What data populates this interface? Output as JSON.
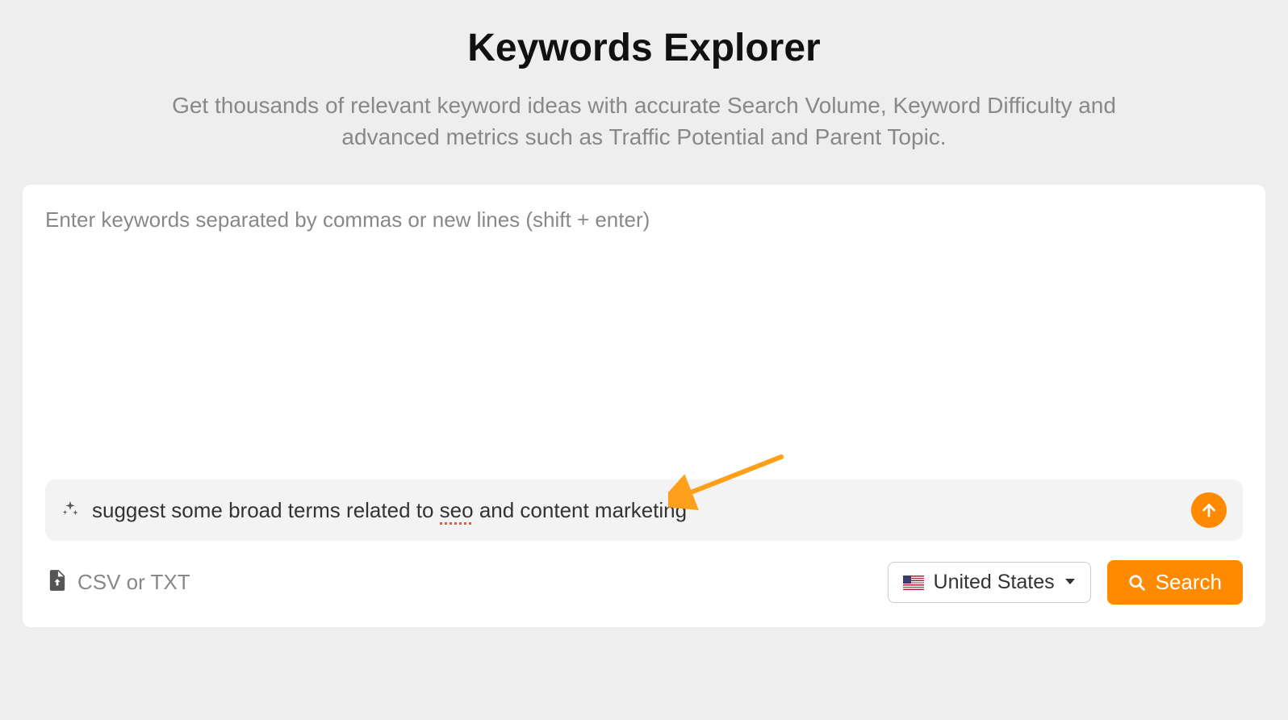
{
  "header": {
    "title": "Keywords Explorer",
    "subtitle": "Get thousands of relevant keyword ideas with accurate Search Volume, Keyword Difficulty and advanced metrics such as Traffic Potential and Parent Topic."
  },
  "keywords_input": {
    "placeholder": "Enter keywords separated by commas or new lines (shift + enter)",
    "value": ""
  },
  "ai_bar": {
    "text_pre": "suggest some broad terms related to ",
    "spellcheck_word": "seo",
    "text_post": " and content marketing"
  },
  "upload": {
    "label": "CSV or TXT"
  },
  "country": {
    "label": "United States"
  },
  "search": {
    "label": "Search"
  },
  "colors": {
    "accent": "#ff8a00",
    "page_bg": "#eeeeee",
    "panel_bg": "#ffffff",
    "muted_text": "#888888"
  }
}
